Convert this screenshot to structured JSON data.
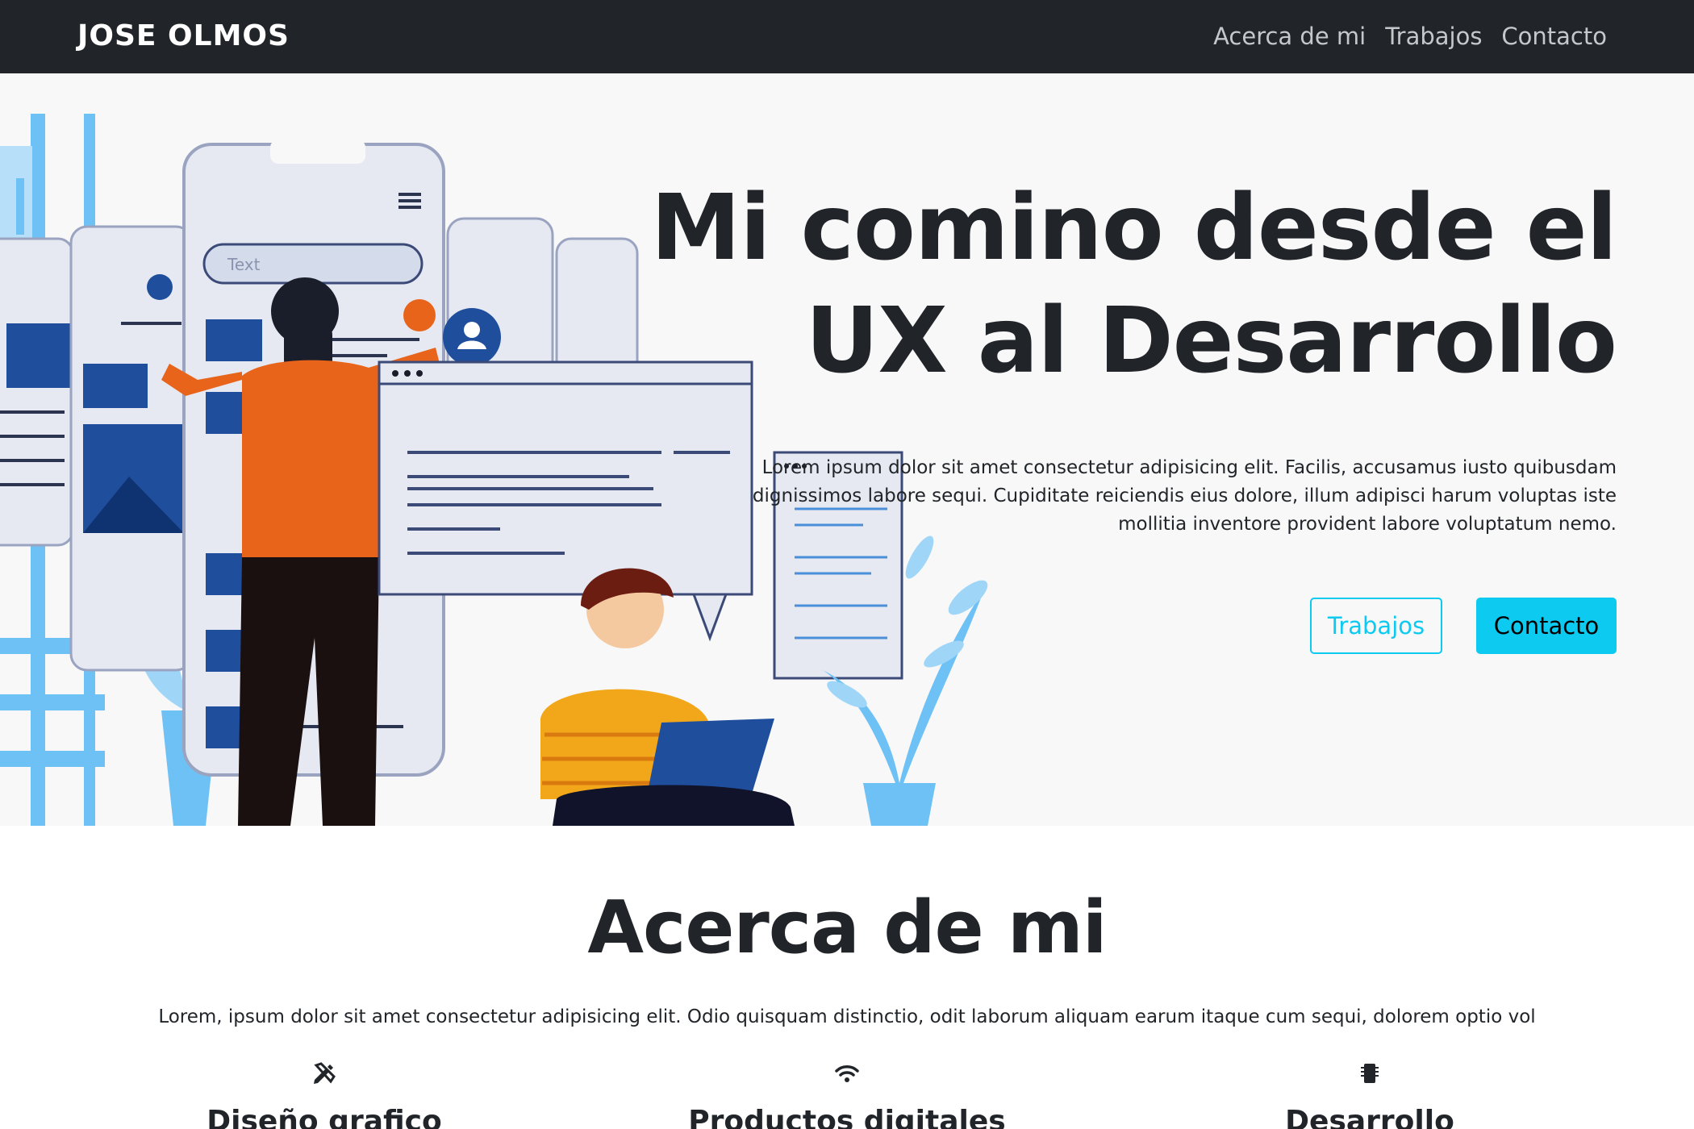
{
  "navbar": {
    "brand": "JOSE OLMOS",
    "links": [
      "Acerca de mi",
      "Trabajos",
      "Contacto"
    ]
  },
  "hero": {
    "title": "Mi comino desde el UX al Desarrollo",
    "text": "Lorem ipsum dolor sit amet consectetur adipisicing elit. Facilis, accusamus iusto quibusdam dignissimos labore sequi. Cupiditate reiciendis eius dolore, illum adipisci harum voluptas iste mollitia inventore provident labore voluptatum nemo.",
    "buttons": {
      "works": "Trabajos",
      "contact": "Contacto"
    },
    "illustration": {
      "search_placeholder": "Text"
    }
  },
  "about": {
    "title": "Acerca de mi",
    "text": "Lorem, ipsum dolor sit amet consectetur adipisicing elit. Odio quisquam distinctio, odit laborum aliquam earum itaque cum sequi, dolorem optio vol",
    "features": [
      {
        "icon": "pencil-ruler-icon",
        "title": "Diseño grafico"
      },
      {
        "icon": "wifi-icon",
        "title": "Productos digitales"
      },
      {
        "icon": "phone-chip-icon",
        "title": "Desarrollo"
      }
    ]
  },
  "colors": {
    "navbar_bg": "#212529",
    "accent": "#0dcaf0",
    "hero_bg": "#f8f8f9",
    "illustration_blue": "#1f4e9c",
    "illustration_light_blue": "#6ec1f5",
    "illustration_orange": "#e8641a"
  }
}
